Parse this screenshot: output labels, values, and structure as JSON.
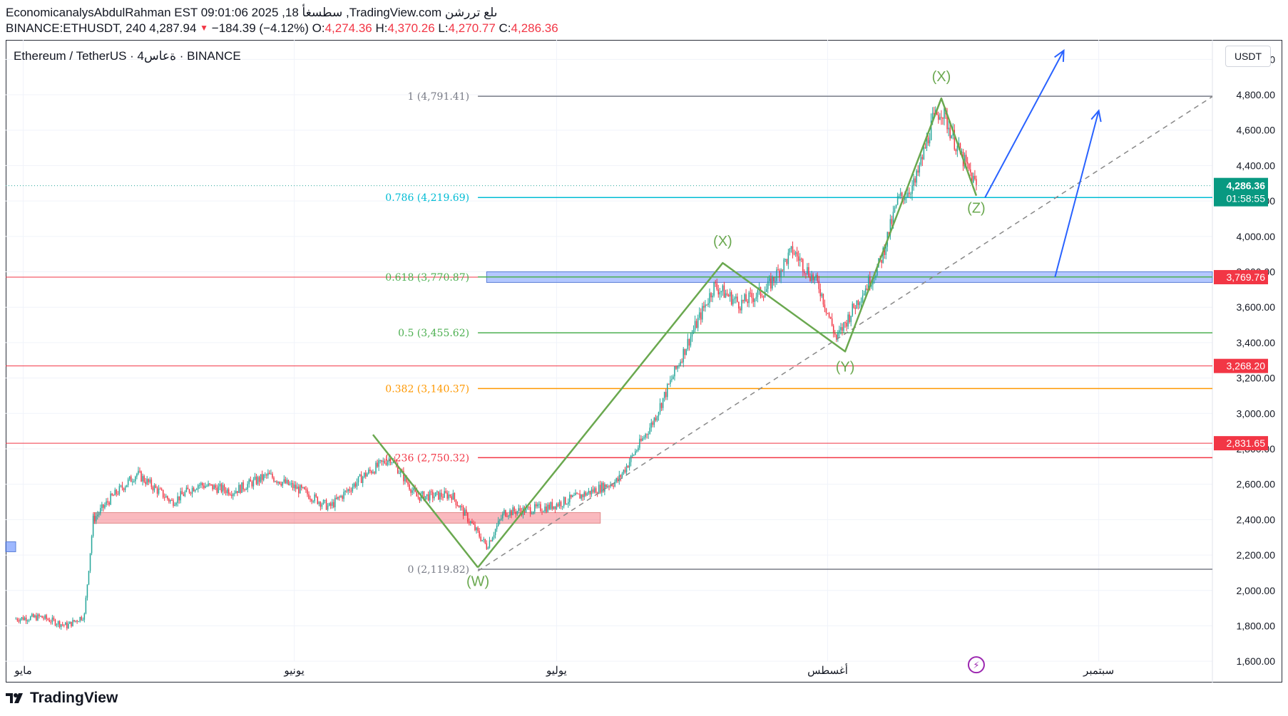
{
  "header": {
    "line1": "EconomicanalysAbdulRahman EST 09:01:06 2025 ,18 سطسغأ ,TradingView.com ىلع تررشن",
    "symbol": "BINANCE:ETHUSDT, 240",
    "last": "4,287.94",
    "change": "−184.39 (−4.12%)",
    "o_label": "O:",
    "o_value": "4,274.36",
    "h_label": "H:",
    "h_value": "4,370.26",
    "l_label": "L:",
    "l_value": "4,270.77",
    "c_label": "C:",
    "c_value": "4,286.36"
  },
  "legend": "Ethereum / TetherUS · 4ةعاس · BINANCE",
  "price_axis_unit": "USDT",
  "footer": {
    "brand": "TradingView"
  },
  "colors": {
    "up": "#26a69a",
    "down": "#f23645",
    "wave": "#6aa84f",
    "arrow": "#2962ff",
    "fib_1": "#787b86",
    "fib_786": "#00bcd4",
    "fib_618": "#4caf50",
    "fib_5": "#4caf50",
    "fib_382": "#ff9800",
    "fib_236": "#f23645",
    "fib_0": "#787b86",
    "hline": "#f23645"
  },
  "chart_data": {
    "type": "candlestick",
    "title": "",
    "y_axis": {
      "ticks": [
        "1,600.00",
        "1,800.00",
        "2,000.00",
        "2,200.00",
        "2,400.00",
        "2,600.00",
        "2,800.00",
        "3,000.00",
        "3,200.00",
        "3,400.00",
        "3,600.00",
        "3,800.00",
        "4,000.00",
        "4,200.00",
        "4,400.00",
        "4,600.00",
        "4,800.00",
        "5,000.00"
      ],
      "range": [
        1480,
        5110
      ]
    },
    "x_axis": {
      "labels": [
        {
          "text": "مايو",
          "date": "2025-05-01"
        },
        {
          "text": "يونيو",
          "date": "2025-06-01"
        },
        {
          "text": "يوليو",
          "date": "2025-07-01"
        },
        {
          "text": "أغسطس",
          "date": "2025-08-01"
        },
        {
          "text": "سبتمبر",
          "date": "2025-09-01"
        }
      ]
    },
    "price_path": [
      [
        "2025-04-30",
        1840
      ],
      [
        "2025-05-03",
        1850
      ],
      [
        "2025-05-06",
        1800
      ],
      [
        "2025-05-08",
        1860
      ],
      [
        "2025-05-09",
        2400
      ],
      [
        "2025-05-11",
        2520
      ],
      [
        "2025-05-14",
        2660
      ],
      [
        "2025-05-18",
        2500
      ],
      [
        "2025-05-21",
        2600
      ],
      [
        "2025-05-25",
        2560
      ],
      [
        "2025-05-29",
        2650
      ],
      [
        "2025-06-02",
        2560
      ],
      [
        "2025-06-05",
        2470
      ],
      [
        "2025-06-09",
        2650
      ],
      [
        "2025-06-12",
        2750
      ],
      [
        "2025-06-15",
        2530
      ],
      [
        "2025-06-19",
        2540
      ],
      [
        "2025-06-23",
        2250
      ],
      [
        "2025-06-25",
        2440
      ],
      [
        "2025-06-30",
        2470
      ],
      [
        "2025-07-04",
        2540
      ],
      [
        "2025-07-08",
        2620
      ],
      [
        "2025-07-12",
        2950
      ],
      [
        "2025-07-16",
        3400
      ],
      [
        "2025-07-19",
        3720
      ],
      [
        "2025-07-22",
        3620
      ],
      [
        "2025-07-25",
        3700
      ],
      [
        "2025-07-28",
        3920
      ],
      [
        "2025-07-31",
        3720
      ],
      [
        "2025-08-02",
        3420
      ],
      [
        "2025-08-04",
        3600
      ],
      [
        "2025-08-07",
        3850
      ],
      [
        "2025-08-09",
        4200
      ],
      [
        "2025-08-11",
        4300
      ],
      [
        "2025-08-13",
        4650
      ],
      [
        "2025-08-14",
        4720
      ],
      [
        "2025-08-16",
        4480
      ],
      [
        "2025-08-18",
        4286
      ]
    ],
    "horizontal_levels": [
      "3,769.76",
      "3,268.20",
      "2,831.65"
    ],
    "current_price": {
      "value": "4,286.36",
      "countdown": "01:58:55"
    },
    "fib": [
      {
        "ratio": "1",
        "price": "4,791.41",
        "label": "1 (4,791.41)"
      },
      {
        "ratio": "0.786",
        "price": "4,219.69",
        "label": "0.786 (4,219.69)"
      },
      {
        "ratio": "0.618",
        "price": "3,770.87",
        "label": "0.618 (3,770.87)"
      },
      {
        "ratio": "0.5",
        "price": "3,455.62",
        "label": "0.5 (3,455.62)"
      },
      {
        "ratio": "0.382",
        "price": "3,140.37",
        "label": "0.382 (3,140.37)"
      },
      {
        "ratio": "0.236",
        "price": "2,750.32",
        "label": "0.236 (2,750.32)"
      },
      {
        "ratio": "0",
        "price": "2,119.82",
        "label": "0 (2,119.82)"
      }
    ],
    "waves": [
      {
        "label": "(W)",
        "date": "2025-06-22",
        "price": 2130
      },
      {
        "label": "(X)",
        "date": "2025-07-20",
        "price": 3850
      },
      {
        "label": "(Y)",
        "date": "2025-08-03",
        "price": 3350
      },
      {
        "label": "(X)",
        "date": "2025-08-14",
        "price": 4780
      },
      {
        "label": "(Z)",
        "date": "2025-08-18",
        "price": 4230
      }
    ],
    "zones": [
      {
        "name": "support",
        "from": 2380,
        "to": 2440
      },
      {
        "name": "resistance",
        "from": 3740,
        "to": 3800
      }
    ]
  }
}
